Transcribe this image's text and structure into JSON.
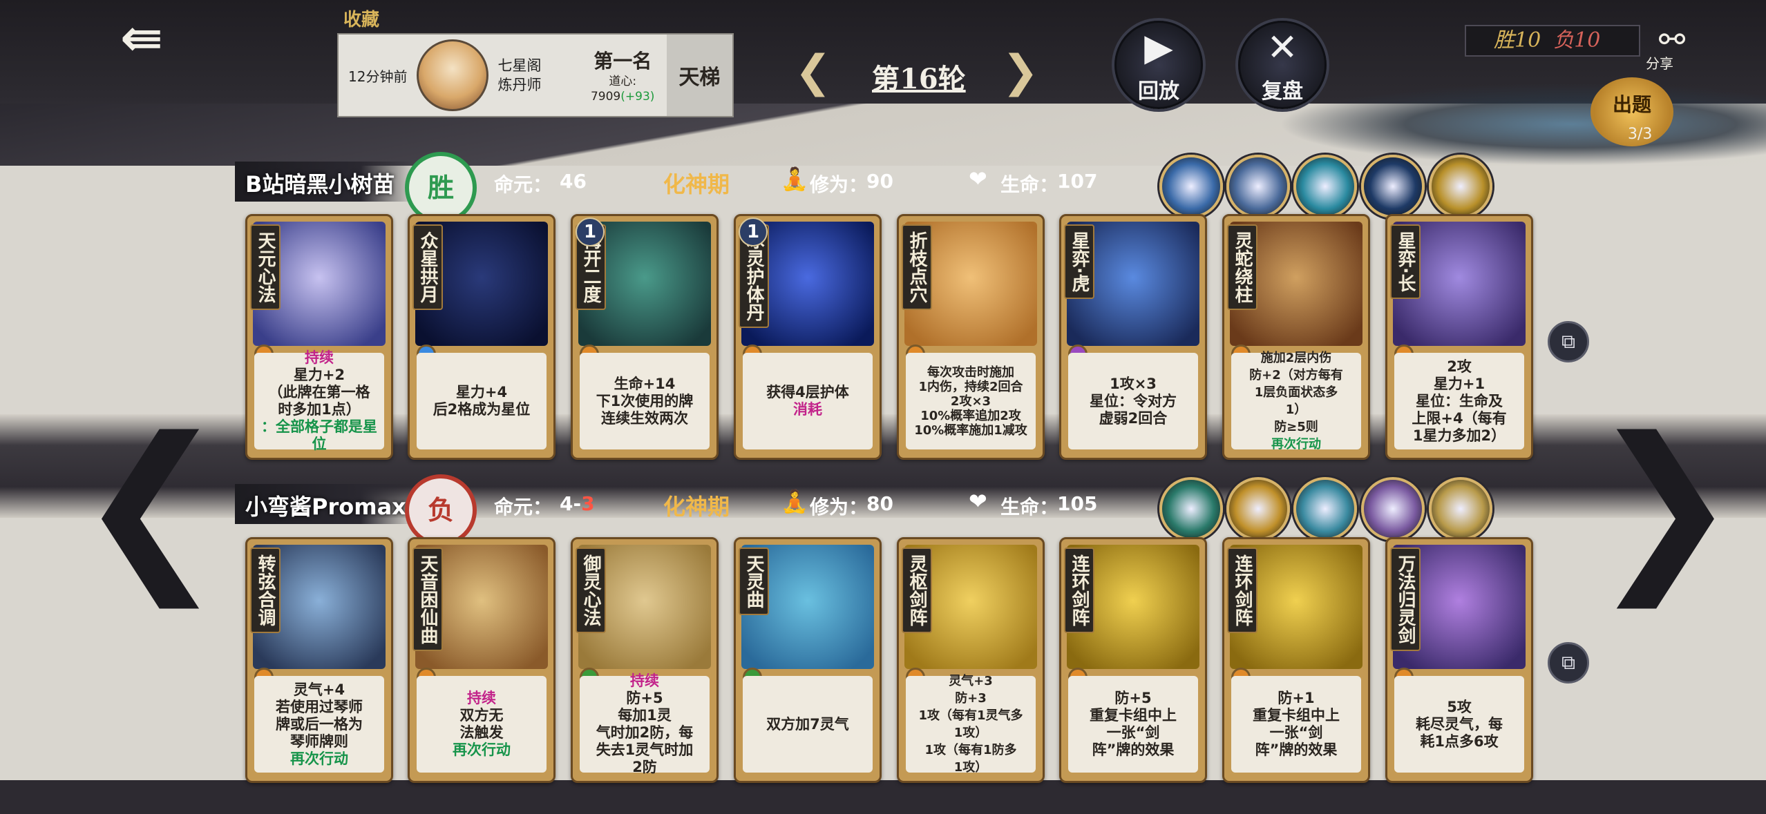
{
  "header": {
    "favorite_label": "收藏",
    "player": {
      "time": "12分钟前",
      "title_line1": "七星阁",
      "title_line2": "炼丹师",
      "rank": "第一名",
      "daoxin_label": "道心:",
      "daoxin_value": "7909",
      "daoxin_delta": "(+93)",
      "ladder": "天梯"
    },
    "round": "第16轮",
    "replay_label": "回放",
    "review_label": "复盘",
    "wins": "胜10",
    "losses": "负10",
    "share_label": "分享",
    "question_label": "出题",
    "question_count": "3/3"
  },
  "rows": [
    {
      "name": "B站暗黑小树苗",
      "result": "胜",
      "life_label": "命元：",
      "life_value": "46",
      "stage": "化神期",
      "cultivation_label": "修为：",
      "cultivation_value": "90",
      "hp_label": "生命：",
      "hp_value": "107",
      "relic_colors": [
        "#3a6aa8",
        "#4a6a9a",
        "#2a8aa0",
        "#1e3a66",
        "#b8902a"
      ],
      "cards": [
        {
          "name": "天元心法",
          "level": "",
          "art": [
            "#c7c2f0",
            "#3a3f8a"
          ],
          "gem": "#e08a2a",
          "text_lines": [
            "星力+2",
            "（此牌在第一格",
            "时多加1点）"
          ],
          "extra_prefix": "持续",
          "extra": "：全部格子都是星位"
        },
        {
          "name": "众星拱月",
          "level": "",
          "art": [
            "#2a3a7a",
            "#0a1030"
          ],
          "gem": "#3a8ae0",
          "text_lines": [
            "星力+4",
            "后2格成为星位"
          ],
          "extra_prefix": "",
          "extra": ""
        },
        {
          "name": "梅开二度",
          "level": "1",
          "art": [
            "#4a9a8a",
            "#1a3a3a"
          ],
          "gem": "#e08a2a",
          "text_lines": [
            "生命+14",
            "下1次使用的牌",
            "连续生效两次"
          ],
          "extra_prefix": "",
          "extra": ""
        },
        {
          "name": "冰灵护体丹",
          "level": "1",
          "art": [
            "#4a6ae0",
            "#0a1a5a"
          ],
          "gem": "#e08a2a",
          "text_lines": [
            "获得4层护体"
          ],
          "extra_prefix": "",
          "extra": "消耗"
        },
        {
          "name": "折枝点穴",
          "level": "",
          "art": [
            "#f0c078",
            "#b0702a"
          ],
          "gem": "#e08a2a",
          "text_lines": [
            "每次攻击时施加",
            "1内伤，持续2回合",
            "2攻×3",
            "10%概率追加2攻",
            "10%概率施加1减攻"
          ],
          "extra_prefix": "",
          "extra": ""
        },
        {
          "name": "星弈·虎",
          "level": "",
          "art": [
            "#5a8ae0",
            "#1a2a5a"
          ],
          "gem": "#9a4ac0",
          "text_lines": [
            "1攻×3",
            "星位：令对方",
            "虚弱2回合"
          ],
          "extra_prefix": "",
          "extra": ""
        },
        {
          "name": "灵蛇绕柱",
          "level": "",
          "art": [
            "#d0a060",
            "#6a3a1a"
          ],
          "gem": "#e08a2a",
          "text_lines": [
            "施加2层内伤",
            "防+2（对方每有",
            "1层负面状态多",
            "1）",
            "防≥5则"
          ],
          "extra_prefix": "",
          "extra": "再次行动"
        },
        {
          "name": "星弈·长",
          "level": "",
          "art": [
            "#a08ae0",
            "#3a2a6a"
          ],
          "gem": "#e08a2a",
          "text_lines": [
            "2攻",
            "星力+1",
            "星位：生命及",
            "上限+4（每有",
            "1星力多加2）"
          ],
          "extra_prefix": "",
          "extra": ""
        }
      ]
    },
    {
      "name": "小弯酱Promax",
      "result": "负",
      "life_label": "命元：",
      "life_value": "4-",
      "life_delta": "3",
      "stage": "化神期",
      "cultivation_label": "修为：",
      "cultivation_value": "80",
      "hp_label": "生命：",
      "hp_value": "105",
      "relic_colors": [
        "#2a7a6a",
        "#c0902a",
        "#3a8aa0",
        "#7a5aa0",
        "#b89a4a"
      ],
      "cards": [
        {
          "name": "转弦合调",
          "level": "",
          "art": [
            "#8ab0d8",
            "#2a3a5a"
          ],
          "gem": "#e08a2a",
          "text_lines": [
            "灵气+4",
            "若使用过琴师",
            "牌或后一格为",
            "琴师牌则"
          ],
          "extra_prefix": "",
          "extra": "再次行动"
        },
        {
          "name": "天音困仙曲",
          "level": "",
          "art": [
            "#e0c080",
            "#8a5a2a"
          ],
          "gem": "#e08a2a",
          "text_lines": [
            "双方无",
            "法触发"
          ],
          "extra_prefix": "持续",
          "extra": "再次行动"
        },
        {
          "name": "御灵心法",
          "level": "",
          "art": [
            "#e0c890",
            "#9a7a3a"
          ],
          "gem": "#3a9a3a",
          "text_lines": [
            "防+5",
            "每加1灵",
            "气时加2防，每",
            "失去1灵气时加",
            "2防"
          ],
          "extra_prefix": "持续",
          "extra": ""
        },
        {
          "name": "天灵曲",
          "level": "",
          "art": [
            "#6ac0e0",
            "#2a6a9a"
          ],
          "gem": "#3a9a3a",
          "text_lines": [
            "双方加7灵气"
          ],
          "extra_prefix": "",
          "extra": ""
        },
        {
          "name": "灵枢剑阵",
          "level": "",
          "art": [
            "#f0d060",
            "#a07a1a"
          ],
          "gem": "#e08a2a",
          "text_lines": [
            "灵气+3",
            "防+3",
            "1攻（每有1灵气多",
            "1攻）",
            "1攻（每有1防多",
            "1攻）"
          ],
          "extra_prefix": "",
          "extra": ""
        },
        {
          "name": "连环剑阵",
          "level": "",
          "art": [
            "#f0d050",
            "#8a6a10"
          ],
          "gem": "#e08a2a",
          "text_lines": [
            "防+5",
            "重复卡组中上",
            "一张“剑",
            "阵”牌的效果"
          ],
          "extra_prefix": "",
          "extra": ""
        },
        {
          "name": "连环剑阵",
          "level": "",
          "art": [
            "#f0d050",
            "#8a6a10"
          ],
          "gem": "#e08a2a",
          "text_lines": [
            "防+1",
            "重复卡组中上",
            "一张“剑",
            "阵”牌的效果"
          ],
          "extra_prefix": "",
          "extra": ""
        },
        {
          "name": "万法归灵剑",
          "level": "",
          "art": [
            "#b080e0",
            "#3a2a6a"
          ],
          "gem": "#e08a2a",
          "text_lines": [
            "5攻",
            "耗尽灵气，每",
            "耗1点多6攻"
          ],
          "extra_prefix": "",
          "extra": ""
        }
      ]
    }
  ],
  "nav": {
    "left": "‹",
    "right": "›"
  }
}
